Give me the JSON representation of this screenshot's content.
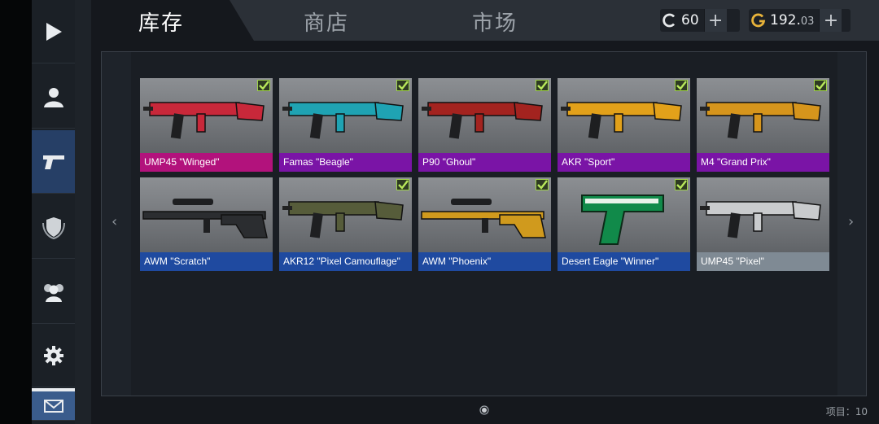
{
  "tabs": [
    {
      "label": "库存",
      "active": true
    },
    {
      "label": "商店",
      "active": false
    },
    {
      "label": "市场",
      "active": false
    }
  ],
  "currency": {
    "credits": {
      "icon": "c-coin-icon",
      "value": "60"
    },
    "gold": {
      "icon": "g-coin-icon",
      "value_main": "192.",
      "value_fraction": "03"
    },
    "add_symbol": "+"
  },
  "sidebar": [
    {
      "name": "play",
      "icon": "play-icon"
    },
    {
      "name": "profile",
      "icon": "user-icon"
    },
    {
      "name": "inventory",
      "icon": "pistol-icon",
      "active": true
    },
    {
      "name": "clan",
      "icon": "shield-icon"
    },
    {
      "name": "friends",
      "icon": "group-icon"
    },
    {
      "name": "settings",
      "icon": "gear-icon"
    },
    {
      "name": "mail",
      "icon": "mail-icon"
    }
  ],
  "nav": {
    "prev": "‹",
    "next": "›"
  },
  "items": [
    {
      "name": "UMP45 \"Winged\"",
      "rarity_color": "#b2127c",
      "equipped": true,
      "weapon_color": "#c8283a"
    },
    {
      "name": "Famas \"Beagle\"",
      "rarity_color": "#7a14a6",
      "equipped": true,
      "weapon_color": "#1fa3b3"
    },
    {
      "name": "P90 \"Ghoul\"",
      "rarity_color": "#7a14a6",
      "equipped": true,
      "weapon_color": "#a3231f"
    },
    {
      "name": "AKR \"Sport\"",
      "rarity_color": "#7a14a6",
      "equipped": true,
      "weapon_color": "#e2a11a"
    },
    {
      "name": "M4 \"Grand Prix\"",
      "rarity_color": "#7a14a6",
      "equipped": true,
      "weapon_color": "#d6951c"
    },
    {
      "name": "AWM \"Scratch\"",
      "rarity_color": "#1f4aa0",
      "equipped": false,
      "weapon_color": "#2b2d30"
    },
    {
      "name": "AKR12 \"Pixel Camouflage\"",
      "rarity_color": "#1f4aa0",
      "equipped": true,
      "weapon_color": "#565c3a"
    },
    {
      "name": "AWM \"Phoenix\"",
      "rarity_color": "#1f4aa0",
      "equipped": true,
      "weapon_color": "#d09a1d"
    },
    {
      "name": "Desert Eagle \"Winner\"",
      "rarity_color": "#1f4aa0",
      "equipped": true,
      "weapon_color": "#118a4a"
    },
    {
      "name": "UMP45 \"Pixel\"",
      "rarity_color": "#7f8a94",
      "equipped": false,
      "weapon_color": "#c9cbcd"
    }
  ],
  "footer": {
    "count_label": "项目：10"
  }
}
